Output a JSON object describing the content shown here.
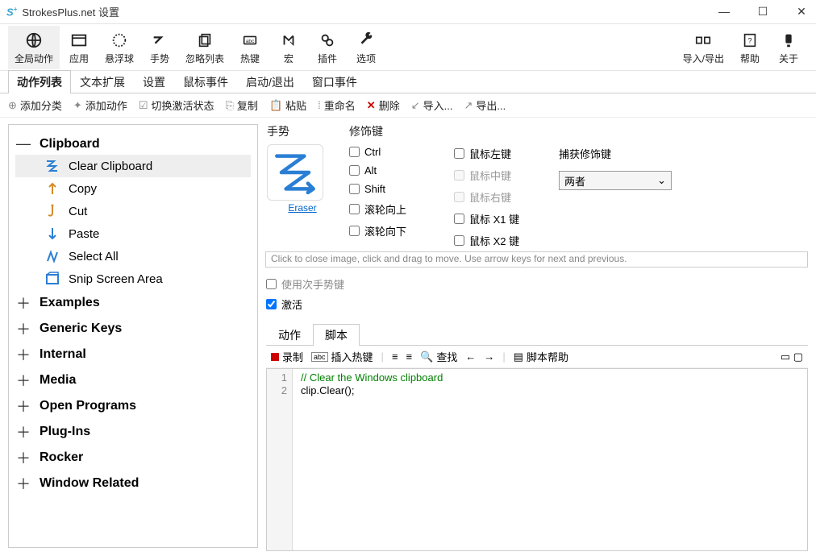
{
  "window": {
    "title": "StrokesPlus.net 设置"
  },
  "toolbar": [
    {
      "id": "global",
      "label": "全局动作"
    },
    {
      "id": "apps",
      "label": "应用"
    },
    {
      "id": "float",
      "label": "悬浮球"
    },
    {
      "id": "gestures",
      "label": "手势"
    },
    {
      "id": "ignore",
      "label": "忽略列表"
    },
    {
      "id": "hotkeys",
      "label": "热键"
    },
    {
      "id": "macro",
      "label": "宏"
    },
    {
      "id": "plugins",
      "label": "插件"
    },
    {
      "id": "options",
      "label": "选项"
    }
  ],
  "toolbar_right": [
    {
      "id": "importexport",
      "label": "导入/导出"
    },
    {
      "id": "help",
      "label": "帮助"
    },
    {
      "id": "about",
      "label": "关于"
    }
  ],
  "subtabs": [
    "动作列表",
    "文本扩展",
    "设置",
    "鼠标事件",
    "启动/退出",
    "窗口事件"
  ],
  "actionbar": [
    "添加分类",
    "添加动作",
    "切换激活状态",
    "复制",
    "粘贴",
    "重命名",
    "删除",
    "导入...",
    "导出..."
  ],
  "tree": {
    "expanded_cat": "Clipboard",
    "items": [
      {
        "label": "Clear Clipboard",
        "selected": true
      },
      {
        "label": "Copy"
      },
      {
        "label": "Cut"
      },
      {
        "label": "Paste"
      },
      {
        "label": "Select All"
      },
      {
        "label": "Snip Screen Area"
      }
    ],
    "cats": [
      "Examples",
      "Generic Keys",
      "Internal",
      "Media",
      "Open Programs",
      "Plug-Ins",
      "Rocker",
      "Window Related"
    ]
  },
  "gesture": {
    "title": "手势",
    "link": "Eraser"
  },
  "modifiers": {
    "title": "修饰键",
    "col1": [
      "Ctrl",
      "Alt",
      "Shift",
      "滚轮向上",
      "滚轮向下"
    ],
    "col2": [
      {
        "label": "鼠标左键"
      },
      {
        "label": "鼠标中键",
        "disabled": true
      },
      {
        "label": "鼠标右键",
        "disabled": true
      },
      {
        "label": "鼠标 X1 键"
      },
      {
        "label": "鼠标 X2 键"
      }
    ]
  },
  "capture": {
    "title": "捕获修饰键",
    "value": "两者"
  },
  "tooltip": "Click to close image, click and drag to move. Use arrow keys for next and previous.",
  "opts": {
    "secondary": "使用次手势键",
    "active": "激活"
  },
  "edittabs": [
    "动作",
    "脚本"
  ],
  "editorbar": {
    "record": "录制",
    "insert_hotkey": "插入热键",
    "search": "查找",
    "script_help": "脚本帮助"
  },
  "code": {
    "line1": "// Clear the Windows clipboard",
    "line2a": "clip",
    "line2b": ".Clear();"
  }
}
